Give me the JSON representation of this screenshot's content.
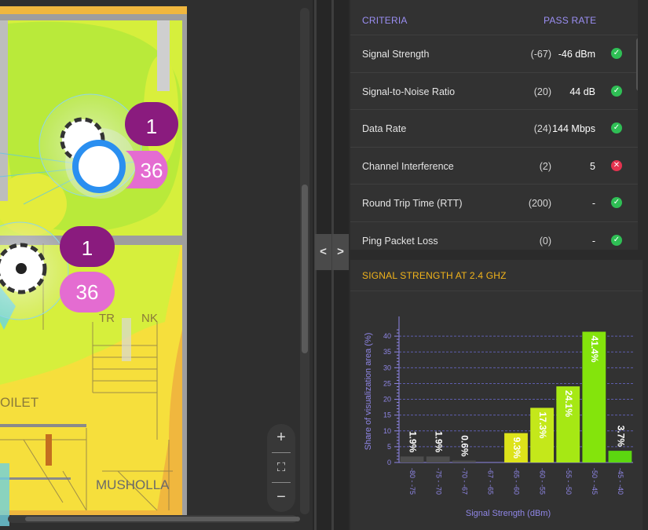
{
  "map": {
    "labels": {
      "tr": "TR",
      "nk": "NK",
      "toilet": "OILET",
      "musholla": "MUSHOLLA"
    },
    "markers": [
      {
        "channel_count": "1",
        "band_count": "36"
      },
      {
        "channel_count": "1",
        "band_count": "36"
      }
    ],
    "zoom": {
      "zoom_in": "+",
      "fit": "⛶",
      "zoom_out": "−"
    }
  },
  "divider": {
    "collapse_left": "<",
    "collapse_right": ">"
  },
  "criteria": {
    "header": {
      "criteria": "CRITERIA",
      "pass_rate": "PASS RATE"
    },
    "rows": [
      {
        "name": "Signal Strength",
        "threshold": "(-67)",
        "value": "-46 dBm",
        "status": "pass",
        "icon": "check-icon"
      },
      {
        "name": "Signal-to-Noise Ratio",
        "threshold": "(20)",
        "value": "44 dB",
        "status": "pass",
        "icon": "check-icon"
      },
      {
        "name": "Data Rate",
        "threshold": "(24)",
        "value": "144 Mbps",
        "status": "pass",
        "icon": "check-icon"
      },
      {
        "name": "Channel Interference",
        "threshold": "(2)",
        "value": "5",
        "status": "fail",
        "icon": "cross-icon"
      },
      {
        "name": "Round Trip Time (RTT)",
        "threshold": "(200)",
        "value": "-",
        "status": "pass",
        "icon": "check-icon"
      },
      {
        "name": "Ping Packet Loss",
        "threshold": "(0)",
        "value": "-",
        "status": "pass",
        "icon": "check-icon"
      }
    ]
  },
  "colors": {
    "pass": "#2fbf55",
    "fail": "#e5334f",
    "accent_purple": "#9b8ff4",
    "accent_orange": "#f2b41b"
  },
  "chart_title": "SIGNAL STRENGTH AT 2.4 GHZ",
  "chart_data": {
    "type": "bar",
    "title": "SIGNAL STRENGTH AT 2.4 GHZ",
    "xlabel": "Signal Strength (dBm)",
    "ylabel": "Share of visualization area (%)",
    "ylim": [
      0,
      45
    ],
    "yticks": [
      0,
      5,
      10,
      15,
      20,
      25,
      30,
      35,
      40
    ],
    "grid": true,
    "categories": [
      "-80 - -75",
      "-75 - -70",
      "-70 - -67",
      "-67 - -65",
      "-65 - -60",
      "-60 - -55",
      "-55 - -50",
      "-50 - -45",
      "-45 - -40"
    ],
    "values": [
      1.9,
      1.9,
      0.6,
      0.0,
      9.3,
      17.3,
      24.1,
      41.4,
      3.7
    ],
    "data_labels": [
      "1.9%",
      "1.9%",
      "0.6%",
      "",
      "9.3%",
      "17.3%",
      "24.1%",
      "41.4%",
      "3.7%"
    ],
    "bar_colors": [
      "#4d4d4d",
      "#4d4d4d",
      "#4d4d4d",
      "#4d4d4d",
      "#dde31a",
      "#c4e81a",
      "#a6e814",
      "#84e40c",
      "#5cd710"
    ]
  }
}
